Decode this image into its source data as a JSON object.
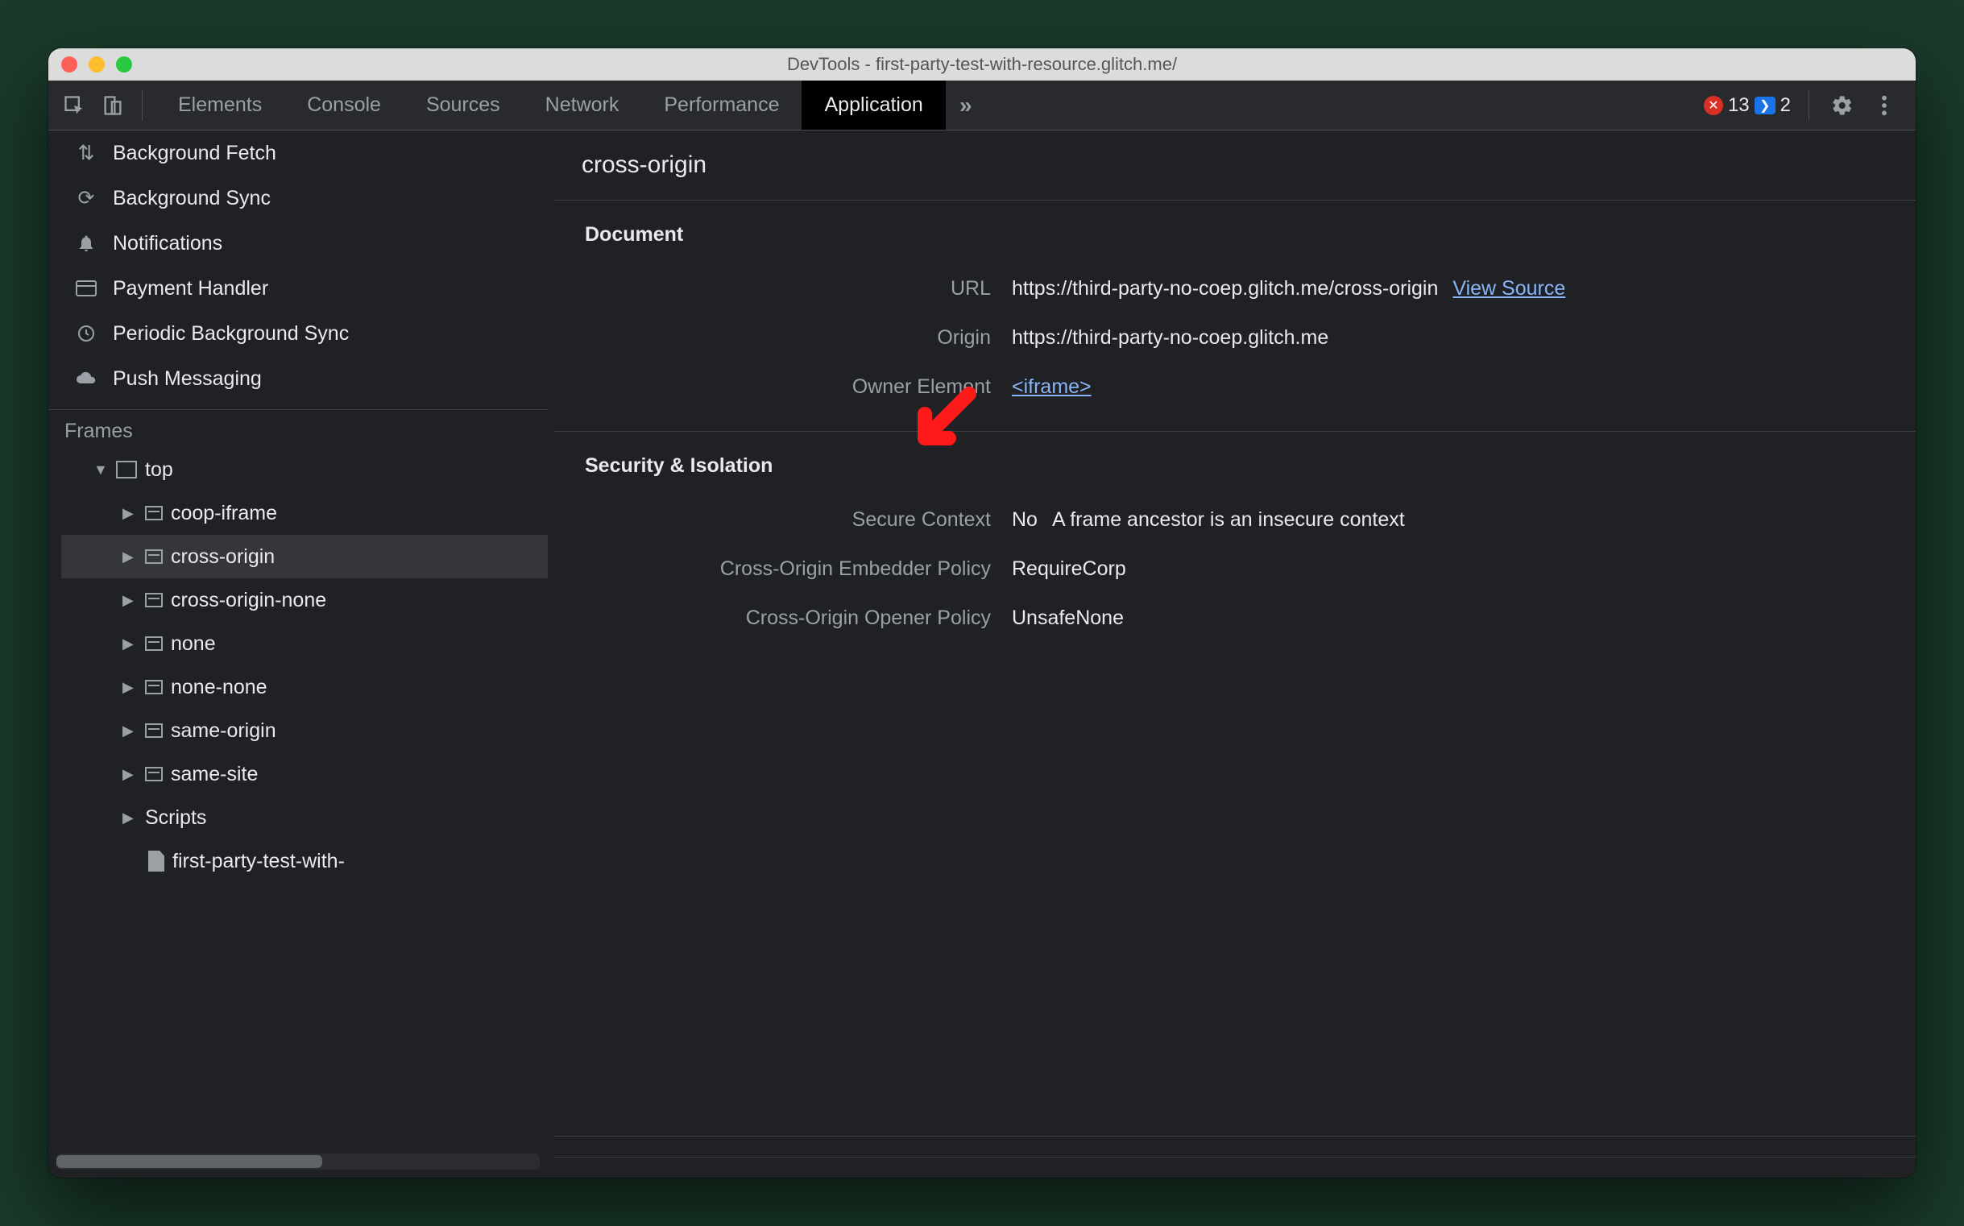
{
  "window": {
    "title": "DevTools - first-party-test-with-resource.glitch.me/"
  },
  "tabs": {
    "items": [
      "Elements",
      "Console",
      "Sources",
      "Network",
      "Performance",
      "Application"
    ],
    "active_index": 5,
    "overflow_glyph": "»"
  },
  "counters": {
    "errors": "13",
    "info": "2"
  },
  "sidebar": {
    "services": [
      {
        "icon": "swap",
        "label": "Background Fetch"
      },
      {
        "icon": "sync",
        "label": "Background Sync"
      },
      {
        "icon": "bell",
        "label": "Notifications"
      },
      {
        "icon": "card",
        "label": "Payment Handler"
      },
      {
        "icon": "clock",
        "label": "Periodic Background Sync"
      },
      {
        "icon": "cloud",
        "label": "Push Messaging"
      }
    ],
    "frames_header": "Frames",
    "tree": {
      "top": "top",
      "children": [
        "coop-iframe",
        "cross-origin",
        "cross-origin-none",
        "none",
        "none-none",
        "same-origin",
        "same-site",
        "Scripts"
      ],
      "selected_index": 1,
      "doc_leaf": "first-party-test-with-"
    }
  },
  "main": {
    "title": "cross-origin",
    "sections": [
      {
        "header": "Document",
        "rows": [
          {
            "k": "URL",
            "v": "https://third-party-no-coep.glitch.me/cross-origin",
            "link": "View Source"
          },
          {
            "k": "Origin",
            "v": "https://third-party-no-coep.glitch.me"
          },
          {
            "k": "Owner Element",
            "linkv": "<iframe>"
          }
        ]
      },
      {
        "header": "Security & Isolation",
        "rows": [
          {
            "k": "Secure Context",
            "v": "No",
            "extra": "A frame ancestor is an insecure context"
          },
          {
            "k": "Cross-Origin Embedder Policy",
            "v": "RequireCorp"
          },
          {
            "k": "Cross-Origin Opener Policy",
            "v": "UnsafeNone"
          }
        ]
      }
    ]
  }
}
